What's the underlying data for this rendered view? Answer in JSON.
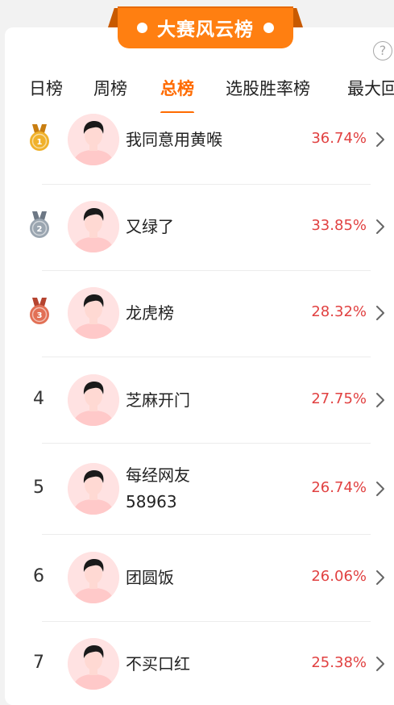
{
  "header": {
    "title": "大赛风云榜"
  },
  "help": {
    "icon": "question-icon",
    "glyph": "?"
  },
  "tabs": [
    {
      "label": "日榜",
      "active": false
    },
    {
      "label": "周榜",
      "active": false
    },
    {
      "label": "总榜",
      "active": true
    },
    {
      "label": "选股胜率榜",
      "active": false
    },
    {
      "label": "最大回",
      "active": false
    }
  ],
  "rankings": [
    {
      "rank": "1",
      "medal": "gold",
      "name_lines": [
        "我同意用黄喉"
      ],
      "pct": "36.74%"
    },
    {
      "rank": "2",
      "medal": "silver",
      "name_lines": [
        "又绿了"
      ],
      "pct": "33.85%"
    },
    {
      "rank": "3",
      "medal": "bronze",
      "name_lines": [
        "龙虎榜"
      ],
      "pct": "28.32%"
    },
    {
      "rank": "4",
      "medal": null,
      "name_lines": [
        "芝麻开门"
      ],
      "pct": "27.75%"
    },
    {
      "rank": "5",
      "medal": null,
      "name_lines": [
        "每经网友",
        "58963"
      ],
      "pct": "26.74%"
    },
    {
      "rank": "6",
      "medal": null,
      "name_lines": [
        "团圆饭"
      ],
      "pct": "26.06%"
    },
    {
      "rank": "7",
      "medal": null,
      "name_lines": [
        "不买口红"
      ],
      "pct": "25.38%"
    }
  ],
  "colors": {
    "accent": "#ff6b00",
    "banner": "#ff7f11",
    "percent": "#e14141",
    "gold": "#e8a020",
    "silver": "#8f9aa6",
    "bronze": "#d9634a",
    "avatar_bg": "#ffe2e2"
  }
}
